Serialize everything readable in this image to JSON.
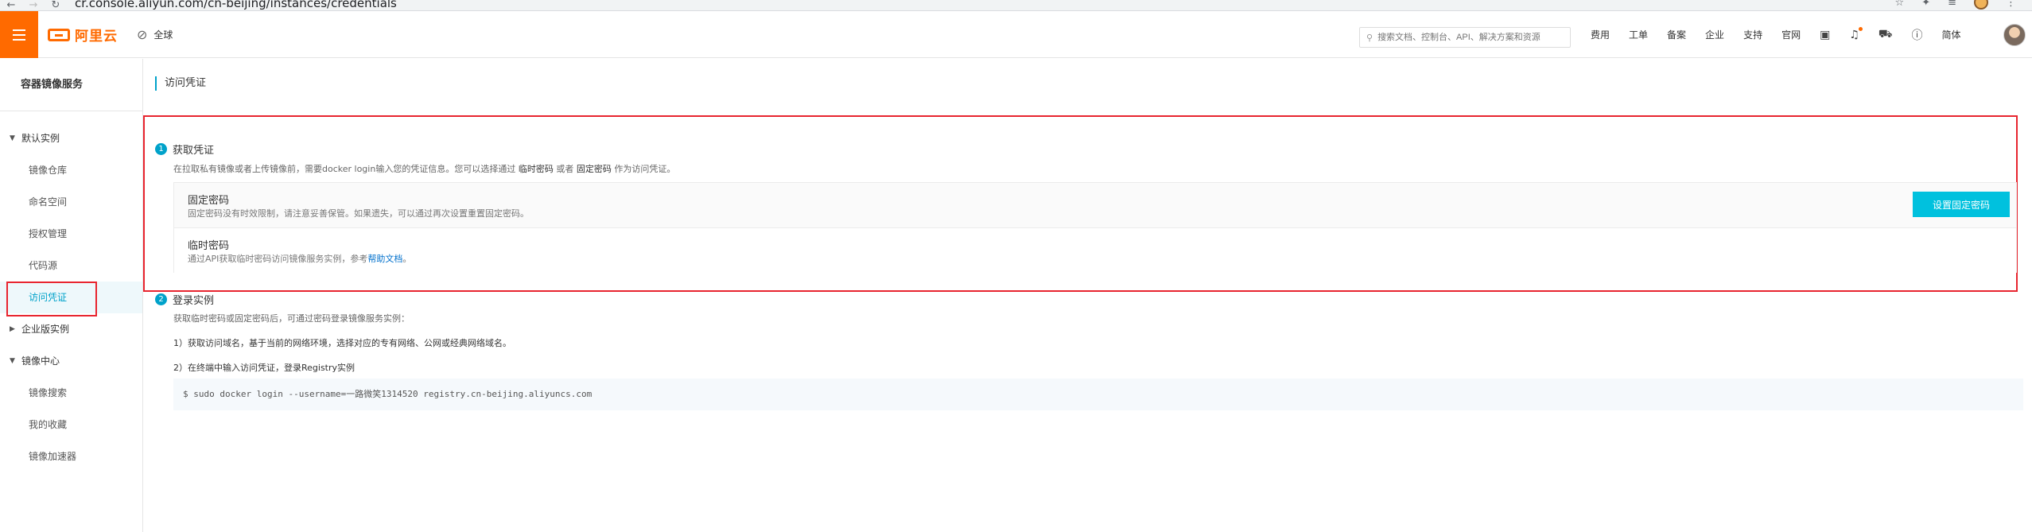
{
  "browser": {
    "url": "cr.console.aliyun.com/cn-beijing/instances/credentials",
    "back_icon": "arrow-left-icon",
    "forward_icon": "arrow-right-icon",
    "reload_icon": "reload-icon"
  },
  "topnav": {
    "logo_text": "阿里云",
    "region_label": "全球",
    "search_placeholder": "搜索文档、控制台、API、解决方案和资源",
    "links": [
      "费用",
      "工单",
      "备案",
      "企业",
      "支持",
      "官网"
    ],
    "lang_label": "简体",
    "accent_color": "#ff6a00"
  },
  "sidebar": {
    "title": "容器镜像服务",
    "groups": [
      {
        "label": "默认实例",
        "expanded": true,
        "items": [
          "镜像仓库",
          "命名空间",
          "授权管理",
          "代码源",
          "访问凭证"
        ]
      },
      {
        "label": "企业版实例",
        "expanded": false,
        "items": []
      },
      {
        "label": "镜像中心",
        "expanded": true,
        "items": [
          "镜像搜索",
          "我的收藏",
          "镜像加速器"
        ]
      }
    ],
    "active_item": "访问凭证",
    "active_color": "#00a2ca"
  },
  "main": {
    "breadcrumb": "访问凭证",
    "step1": {
      "num": "1",
      "title": "获取凭证",
      "desc_prefix": "在拉取私有镜像或者上传镜像前，需要docker login输入您的凭证信息。您可以选择通过 ",
      "desc_temp": "临时密码",
      "desc_or": " 或者 ",
      "desc_fixed": "固定密码",
      "desc_suffix": " 作为访问凭证。",
      "fixed": {
        "title": "固定密码",
        "desc": "固定密码没有时效限制，请注意妥善保管。如果遗失，可以通过再次设置重置固定密码。",
        "button": "设置固定密码"
      },
      "temp": {
        "title": "临时密码",
        "desc_prefix": "通过API获取临时密码访问镜像服务实例，参考",
        "link": "帮助文档",
        "desc_suffix": "。"
      }
    },
    "step2": {
      "num": "2",
      "title": "登录实例",
      "desc": "获取临时密码或固定密码后，可通过密码登录镜像服务实例：",
      "line1": "1）获取访问域名，基于当前的网络环境，选择对应的专有网络、公网或经典网络域名。",
      "line2": "2）在终端中输入访问凭证，登录Registry实例",
      "command": "$ sudo docker login --username=一路微笑1314520 registry.cn-beijing.aliyuncs.com"
    },
    "button_color": "#00c1de",
    "highlight_color": "#e8252f"
  }
}
